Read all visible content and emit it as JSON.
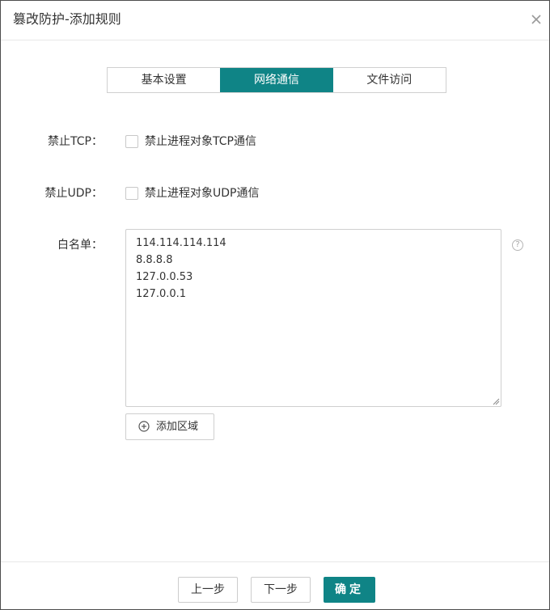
{
  "dialog": {
    "title": "篡改防护-添加规则",
    "close_icon": "close-icon"
  },
  "tabs": [
    {
      "label": "基本设置",
      "active": false
    },
    {
      "label": "网络通信",
      "active": true
    },
    {
      "label": "文件访问",
      "active": false
    }
  ],
  "form": {
    "tcp": {
      "label": "禁止TCP：",
      "option": "禁止进程对象TCP通信",
      "checked": false
    },
    "udp": {
      "label": "禁止UDP：",
      "option": "禁止进程对象UDP通信",
      "checked": false
    },
    "whitelist": {
      "label": "白名单：",
      "lines": [
        "114.114.114.114",
        "8.8.8.8",
        "127.0.0.53",
        "127.0.0.1"
      ],
      "help_icon": "question-icon",
      "help_symbol": "?"
    },
    "add_area": {
      "label": "添加区域",
      "icon": "plus-circle-icon"
    }
  },
  "footer": {
    "prev_label": "上一步",
    "next_label": "下一步",
    "confirm_label": "确定"
  },
  "colors": {
    "accent": "#0f8486",
    "border": "#d0d0d0",
    "text": "#333333"
  }
}
